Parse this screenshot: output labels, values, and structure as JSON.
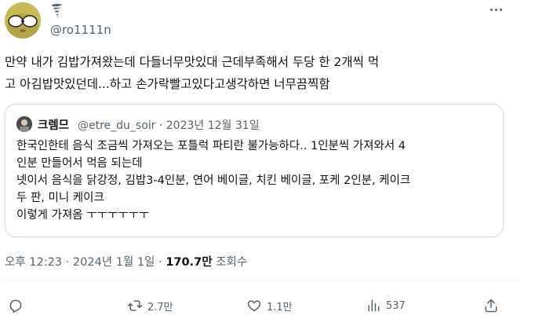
{
  "author": {
    "handle": "@ro1111n",
    "emoji_icon": "tornado-icon"
  },
  "tweet": {
    "lines": [
      "만약 내가 김밥가져왔는데 다들너무맛있대 근데부족해서 두당 한 2개씩 먹",
      "고 아김밥맛있던데...하고 손가락빨고있다고생각하면 너무끔찍함"
    ]
  },
  "quote": {
    "name": "크렘므",
    "meta": "@etre_du_soir · 2023년 12월 31일",
    "lines": [
      "한국인한테 음식 조금씩 가져오는 포틀럭 파티란 불가능하다.. 1인분씩 가져와서 4",
      "인분 만들어서 먹음 되는데",
      "넷이서 음식을 닭강정, 김밥3-4인분, 연어 베이글, 치킨 베이글, 포케 2인분, 케이크",
      "두 판, 미니 케이크",
      "이렇게 가져옴 ㅜㅜㅜㅜㅜㅜ"
    ]
  },
  "timestamp": {
    "time": "오후 12:23 · 2024년 1월 1일 · ",
    "views": "170.7만",
    "views_label": " 조회수"
  },
  "actions": {
    "reply_count": "",
    "retweet_count": "2.7만",
    "like_count": "1.1만",
    "views_count": "537"
  },
  "colors": {
    "text": "#0f1419",
    "secondary": "#536471",
    "border": "#cfd9de"
  }
}
